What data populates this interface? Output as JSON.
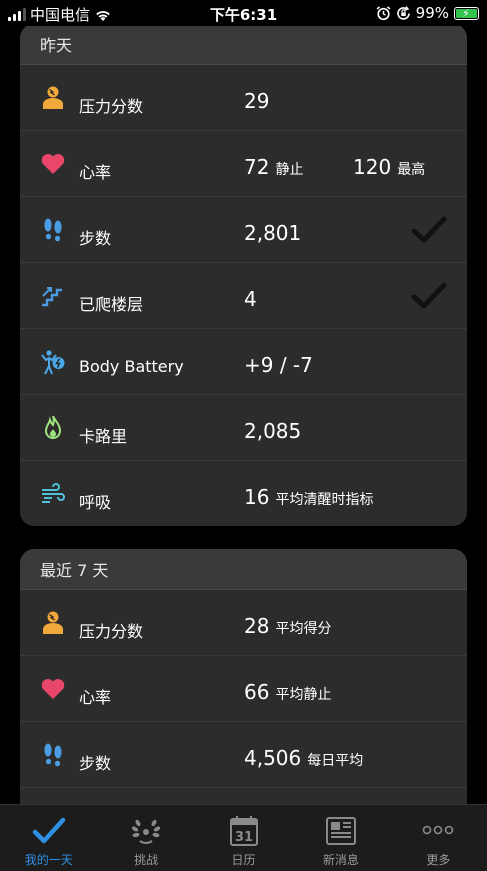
{
  "status_bar": {
    "carrier": "中国电信",
    "time": "下午6:31",
    "battery": "99%"
  },
  "yesterday": {
    "title": "昨天",
    "rows": [
      {
        "label": "压力分数",
        "value": "29",
        "unit": ""
      },
      {
        "label": "心率",
        "value": "72",
        "unit": "静止",
        "value2": "120",
        "unit2": "最高"
      },
      {
        "label": "步数",
        "value": "2,801",
        "unit": ""
      },
      {
        "label": "已爬楼层",
        "value": "4",
        "unit": ""
      },
      {
        "label": "Body Battery",
        "value": "+9 / -7",
        "unit": ""
      },
      {
        "label": "卡路里",
        "value": "2,085",
        "unit": ""
      },
      {
        "label": "呼吸",
        "value": "16",
        "unit": "平均清醒时指标"
      }
    ]
  },
  "last7": {
    "title": "最近 7 天",
    "rows": [
      {
        "label": "压力分数",
        "value": "28",
        "unit": "平均得分"
      },
      {
        "label": "心率",
        "value": "66",
        "unit": "平均静止"
      },
      {
        "label": "步数",
        "value": "4,506",
        "unit": "每日平均"
      }
    ]
  },
  "tabbar": {
    "my_day": "我的一天",
    "challenges": "挑战",
    "calendar": "日历",
    "calendar_day": "31",
    "news": "新消息",
    "more": "更多"
  },
  "colors": {
    "stress": "#f2a93b",
    "heart": "#e8476a",
    "steps": "#4a9de3",
    "floors": "#4a9de3",
    "battery": "#4aa8e8",
    "calories": "#9ee37d",
    "respiration": "#4fc3d9",
    "active_tab": "#2f8fe3"
  }
}
